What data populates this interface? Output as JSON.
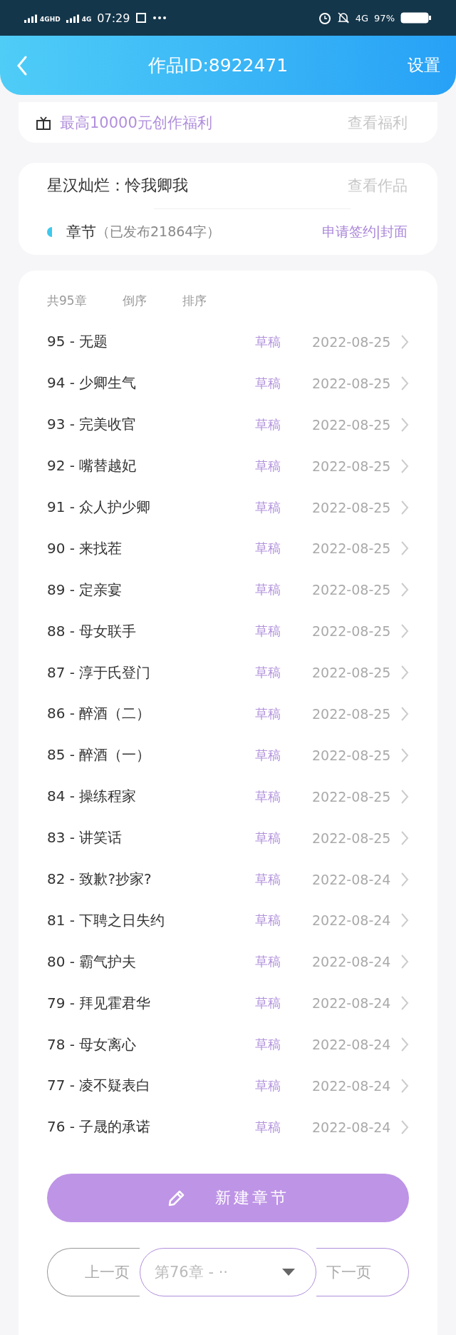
{
  "status_bar": {
    "signal_1": "4GHD",
    "signal_2": "4G",
    "time": "07:29",
    "network": "4G",
    "battery": "97%"
  },
  "header": {
    "title": "作品ID:8922471",
    "action": "设置"
  },
  "benefit": {
    "text": "最高10000元创作福利",
    "link": "查看福利"
  },
  "work": {
    "title": "星汉灿烂：怜我卿我",
    "link": "查看作品",
    "chapters_label": "章节",
    "published": "（已发布21864字）",
    "actions": "申请签约|封面"
  },
  "chapter_list": {
    "count": "共95章",
    "reverse": "倒序",
    "sort": "排序",
    "chapters": [
      {
        "title": "95 - 无题",
        "status": "草稿",
        "date": "2022-08-25"
      },
      {
        "title": "94 - 少卿生气",
        "status": "草稿",
        "date": "2022-08-25"
      },
      {
        "title": "93 - 完美收官",
        "status": "草稿",
        "date": "2022-08-25"
      },
      {
        "title": "92 - 嘴替越妃",
        "status": "草稿",
        "date": "2022-08-25"
      },
      {
        "title": "91 - 众人护少卿",
        "status": "草稿",
        "date": "2022-08-25"
      },
      {
        "title": "90 - 来找茬",
        "status": "草稿",
        "date": "2022-08-25"
      },
      {
        "title": "89 - 定亲宴",
        "status": "草稿",
        "date": "2022-08-25"
      },
      {
        "title": "88 - 母女联手",
        "status": "草稿",
        "date": "2022-08-25"
      },
      {
        "title": "87 - 淳于氏登门",
        "status": "草稿",
        "date": "2022-08-25"
      },
      {
        "title": "86 - 醉酒（二）",
        "status": "草稿",
        "date": "2022-08-25"
      },
      {
        "title": "85 - 醉酒（一）",
        "status": "草稿",
        "date": "2022-08-25"
      },
      {
        "title": "84 - 操练程家",
        "status": "草稿",
        "date": "2022-08-25"
      },
      {
        "title": "83 - 讲笑话",
        "status": "草稿",
        "date": "2022-08-25"
      },
      {
        "title": "82 - 致歉?抄家?",
        "status": "草稿",
        "date": "2022-08-24"
      },
      {
        "title": "81 - 下聘之日失约",
        "status": "草稿",
        "date": "2022-08-24"
      },
      {
        "title": "80 - 霸气护夫",
        "status": "草稿",
        "date": "2022-08-24"
      },
      {
        "title": "79 - 拜见霍君华",
        "status": "草稿",
        "date": "2022-08-24"
      },
      {
        "title": "78 - 母女离心",
        "status": "草稿",
        "date": "2022-08-24"
      },
      {
        "title": "77 - 凌不疑表白",
        "status": "草稿",
        "date": "2022-08-24"
      },
      {
        "title": "76 - 子晟的承诺",
        "status": "草稿",
        "date": "2022-08-24"
      }
    ]
  },
  "new_chapter_button": "新建章节",
  "pagination": {
    "prev": {
      "label": "上一页",
      "disabled": true
    },
    "selector": "第76章 - ··",
    "next": {
      "label": "下一页",
      "disabled": false
    }
  }
}
